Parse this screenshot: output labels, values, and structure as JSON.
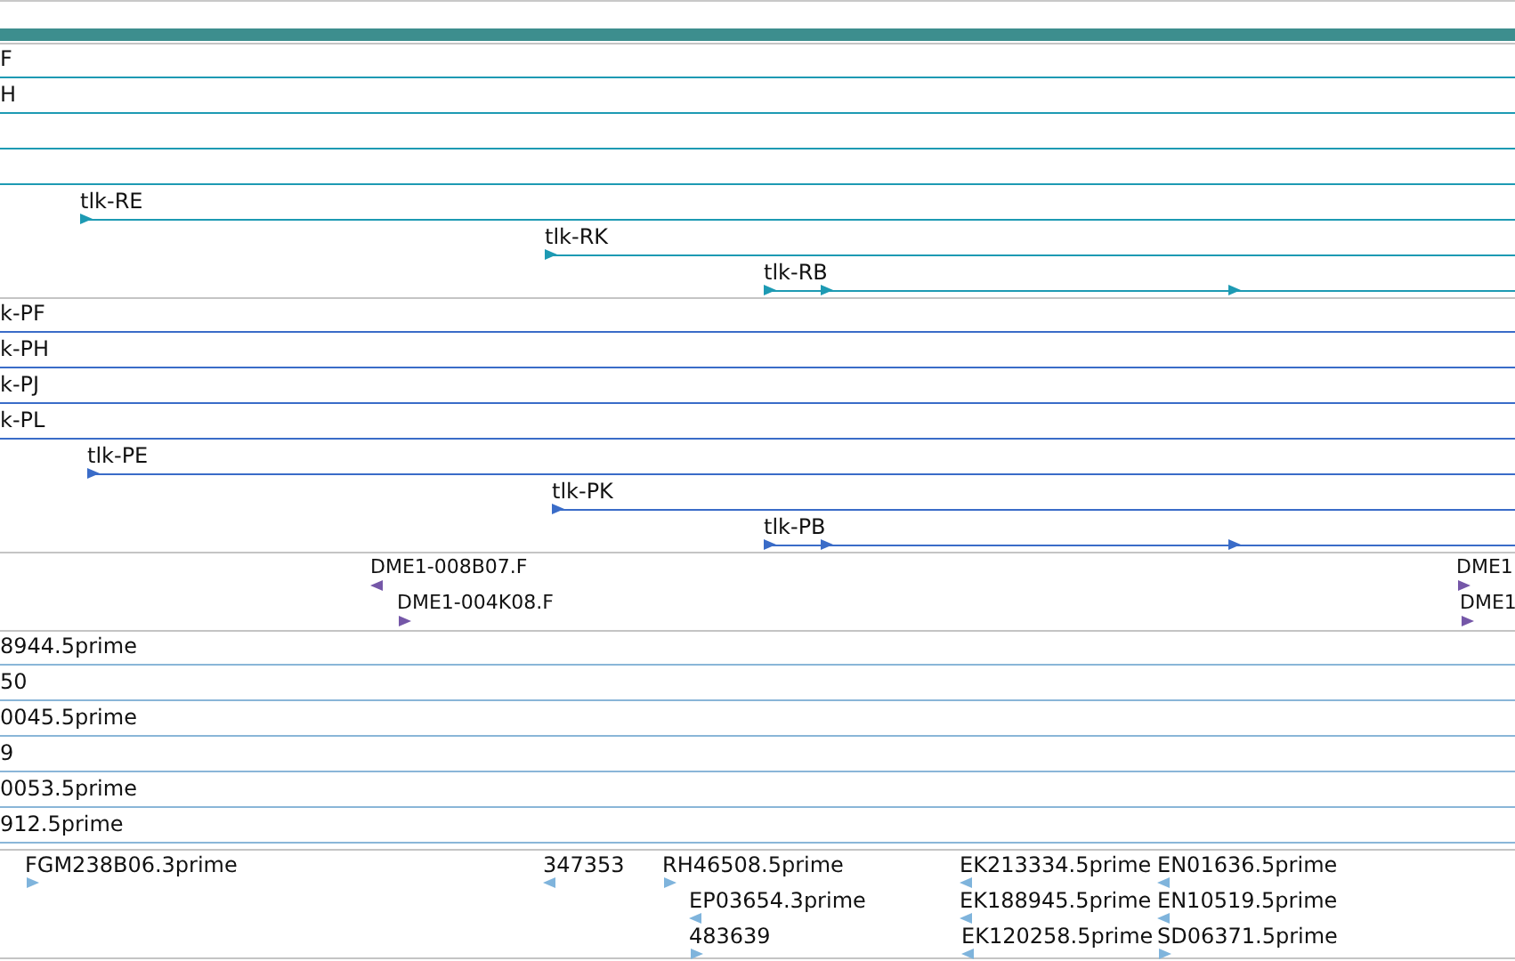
{
  "tracks": [
    {
      "kind": "lines",
      "color": "#1d9ab3",
      "rows": [
        {
          "label": "F",
          "strand_arrows": false
        },
        {
          "label": "H",
          "strand_arrows": false
        },
        {
          "strand_arrows": false
        },
        {
          "strand_arrows": false
        },
        {
          "label": "tlk-RE",
          "strand_arrows": true
        },
        {
          "label": "tlk-RK",
          "strand_arrows": true
        },
        {
          "label": "tlk-RB",
          "strand_arrows": true
        }
      ]
    },
    {
      "kind": "lines",
      "color": "#3a6cc8",
      "rows": [
        {
          "label": "k-PF",
          "strand_arrows": false
        },
        {
          "label": "k-PH",
          "strand_arrows": false
        },
        {
          "label": "k-PJ",
          "strand_arrows": false
        },
        {
          "label": "k-PL",
          "strand_arrows": false
        },
        {
          "label": "tlk-PE",
          "strand_arrows": true
        },
        {
          "label": "tlk-PK",
          "strand_arrows": true
        },
        {
          "label": "tlk-PB",
          "strand_arrows": true
        }
      ]
    },
    {
      "kind": "features",
      "color": "#7557a8",
      "features": [
        {
          "label": "DME1-008B07.F",
          "reverse": true
        },
        {
          "label": "DME1-004K08.F",
          "reverse": false
        },
        {
          "label": "DME1",
          "reverse": false
        },
        {
          "label": "DME1",
          "reverse": false
        }
      ]
    },
    {
      "kind": "lines",
      "color": "#8ab6d8",
      "rows": [
        {
          "label": "8944.5prime",
          "strand_arrows": false
        },
        {
          "label": "50",
          "strand_arrows": false
        },
        {
          "label": "0045.5prime",
          "strand_arrows": false
        },
        {
          "label": "9",
          "strand_arrows": false
        },
        {
          "label": "0053.5prime",
          "strand_arrows": false
        },
        {
          "label": "912.5prime",
          "strand_arrows": false
        }
      ]
    },
    {
      "kind": "features",
      "color": "#7fb4dc",
      "features": [
        {
          "label": "FGM238B06.3prime",
          "reverse": false
        },
        {
          "label": "347353",
          "reverse": true
        },
        {
          "label": "RH46508.5prime",
          "reverse": false
        },
        {
          "label": "EP03654.3prime",
          "reverse": true
        },
        {
          "label": "483639",
          "reverse": false
        },
        {
          "label": "EK213334.5prime",
          "reverse": true
        },
        {
          "label": "EK188945.5prime",
          "reverse": true
        },
        {
          "label": "EK120258.5prime",
          "reverse": true
        },
        {
          "label": "EN01636.5prime",
          "reverse": true
        },
        {
          "label": "EN10519.5prime",
          "reverse": true
        },
        {
          "label": "SD06371.5prime",
          "reverse": false
        }
      ]
    }
  ]
}
